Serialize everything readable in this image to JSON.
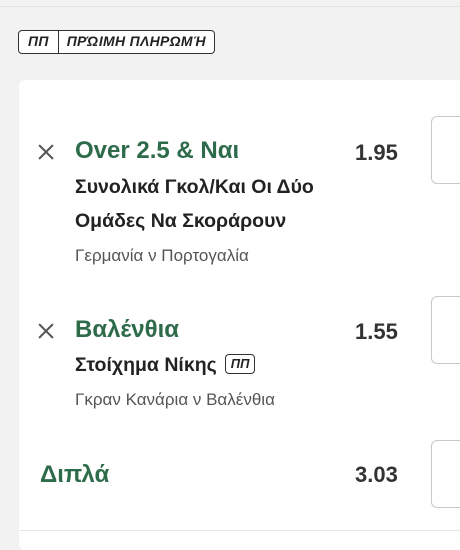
{
  "early_payout_badge": {
    "short": "ΠΠ",
    "label": "ΠΡΏΙΜΗ ΠΛΗΡΩΜΉ"
  },
  "selections": [
    {
      "title": "Over 2.5 & Ναι",
      "odds": "1.95",
      "market_line1": "Συνολικά Γκολ/Και Οι Δύο",
      "market_line2": "Ομάδες Να Σκοράρουν",
      "event": "Γερμανία ν Πορτογαλία"
    },
    {
      "title": "Βαλένθια",
      "odds": "1.55",
      "market_line1": "Στοίχημα Νίκης",
      "market_badge": "ΠΠ",
      "event": "Γκραν Κανάρια ν Βαλένθια"
    }
  ],
  "multiple": {
    "label": "Διπλά",
    "odds": "3.03"
  },
  "colors": {
    "accent_green": "#2e6b4a",
    "background": "#f2f2f2"
  }
}
